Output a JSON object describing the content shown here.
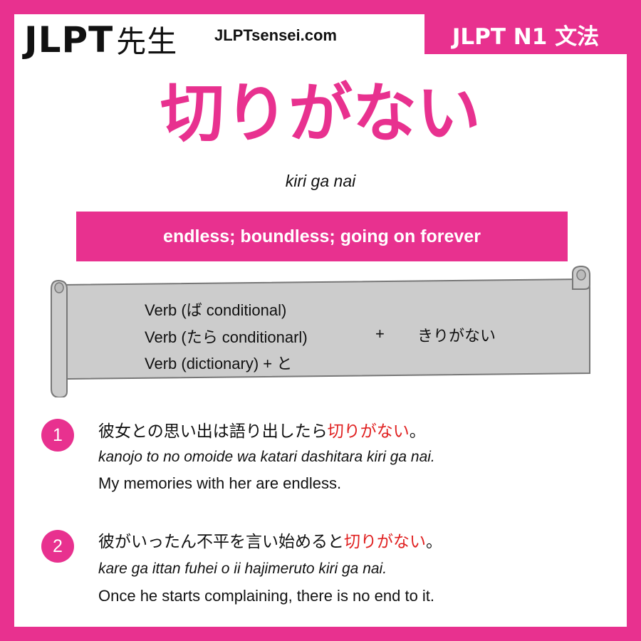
{
  "header": {
    "logo_latin": "JLPT",
    "logo_kanji": "先生",
    "site": "JLPTsensei.com",
    "level_badge": "JLPT N1 文法"
  },
  "grammar": {
    "title": "切りがない",
    "romaji": "kiri ga nai",
    "meaning": "endless; boundless; going on forever"
  },
  "formation": {
    "rules": [
      "Verb (ば conditional)",
      "Verb (たら conditionarl)",
      "Verb (dictionary) + と"
    ],
    "plus": "+",
    "ending": "きりがない"
  },
  "examples": [
    {
      "number": "1",
      "japanese_before": "彼女との思い出は語り出したら",
      "japanese_highlight": "切りがない",
      "japanese_after": "。",
      "romaji": "kanojo to no omoide wa katari dashitara kiri ga nai.",
      "english": "My memories with her are endless."
    },
    {
      "number": "2",
      "japanese_before": "彼がいったん不平を言い始めると",
      "japanese_highlight": "切りがない",
      "japanese_after": "。",
      "romaji": "kare ga ittan fuhei o ii hajimeruto kiri ga nai.",
      "english": "Once he starts complaining, there is no end to it."
    }
  ],
  "colors": {
    "brand_pink": "#e8318f",
    "highlight_red": "#e02020",
    "scroll_gray": "#cccccc"
  }
}
